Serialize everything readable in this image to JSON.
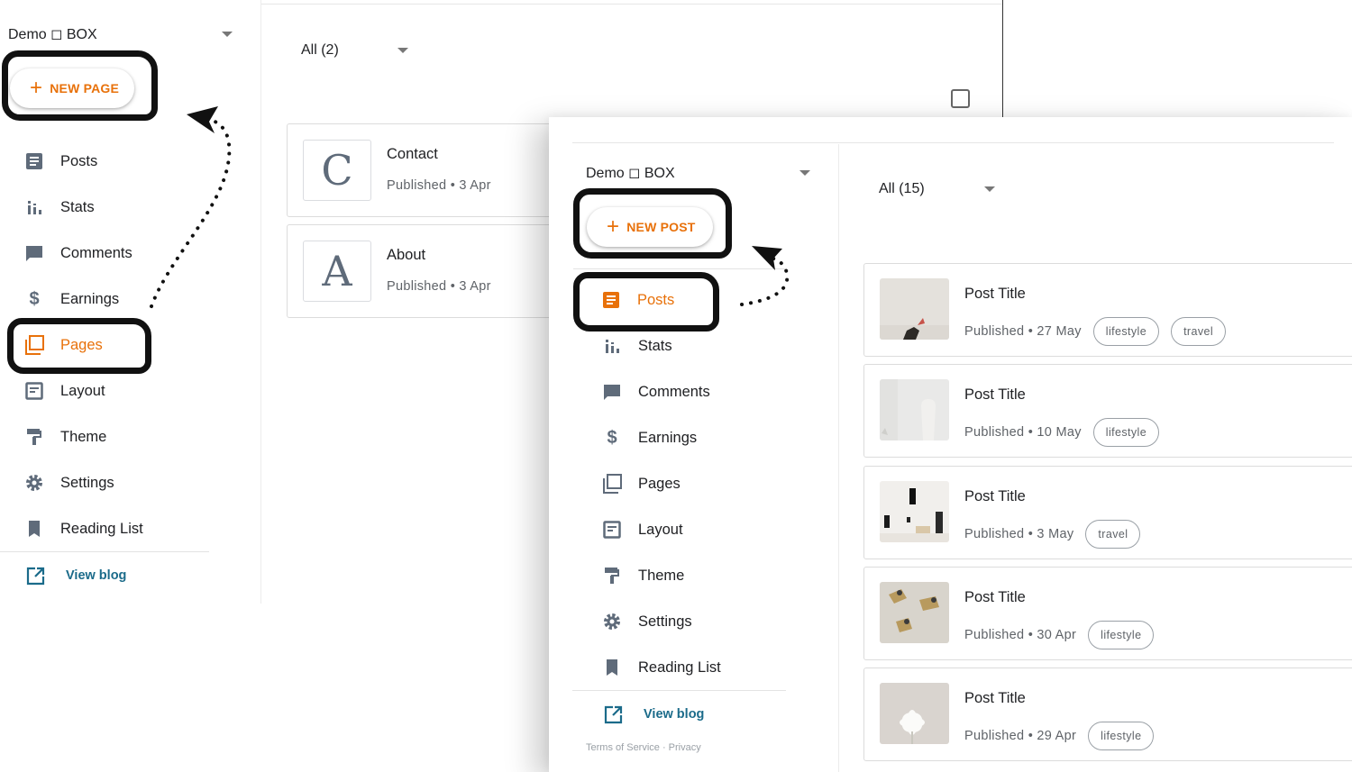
{
  "back_window": {
    "blog_name": "Demo ◻ BOX",
    "new_button_label": "NEW PAGE",
    "filter_label": "All (2)",
    "nav": [
      {
        "label": "Posts",
        "icon": "posts-icon"
      },
      {
        "label": "Stats",
        "icon": "stats-icon"
      },
      {
        "label": "Comments",
        "icon": "comments-icon"
      },
      {
        "label": "Earnings",
        "icon": "earnings-icon"
      },
      {
        "label": "Pages",
        "icon": "pages-icon",
        "active": true
      },
      {
        "label": "Layout",
        "icon": "layout-icon"
      },
      {
        "label": "Theme",
        "icon": "theme-icon"
      },
      {
        "label": "Settings",
        "icon": "settings-icon"
      },
      {
        "label": "Reading List",
        "icon": "reading-list-icon"
      }
    ],
    "view_blog_label": "View blog",
    "pages": [
      {
        "letter": "C",
        "title": "Contact",
        "meta": "Published • 3 Apr"
      },
      {
        "letter": "A",
        "title": "About",
        "meta": "Published • 3 Apr"
      }
    ]
  },
  "front_window": {
    "blog_name": "Demo ◻ BOX",
    "new_button_label": "NEW POST",
    "filter_label": "All (15)",
    "nav": [
      {
        "label": "Posts",
        "icon": "posts-icon",
        "active": true
      },
      {
        "label": "Stats",
        "icon": "stats-icon"
      },
      {
        "label": "Comments",
        "icon": "comments-icon"
      },
      {
        "label": "Earnings",
        "icon": "earnings-icon"
      },
      {
        "label": "Pages",
        "icon": "pages-icon"
      },
      {
        "label": "Layout",
        "icon": "layout-icon"
      },
      {
        "label": "Theme",
        "icon": "theme-icon"
      },
      {
        "label": "Settings",
        "icon": "settings-icon"
      },
      {
        "label": "Reading List",
        "icon": "reading-list-icon"
      }
    ],
    "view_blog_label": "View blog",
    "footer_text": "Terms of Service · Privacy",
    "posts": [
      {
        "title": "Post Title",
        "meta": "Published • 27 May",
        "labels": [
          "lifestyle",
          "travel"
        ]
      },
      {
        "title": "Post Title",
        "meta": "Published • 10 May",
        "labels": [
          "lifestyle"
        ]
      },
      {
        "title": "Post Title",
        "meta": "Published • 3 May",
        "labels": [
          "travel"
        ]
      },
      {
        "title": "Post Title",
        "meta": "Published • 30 Apr",
        "labels": [
          "lifestyle"
        ]
      },
      {
        "title": "Post Title",
        "meta": "Published • 29 Apr",
        "labels": [
          "lifestyle"
        ]
      }
    ]
  },
  "colors": {
    "accent": "#e8710a",
    "link": "#1b6b8a",
    "icon": "#5f6b7a",
    "marker": "#111111"
  }
}
